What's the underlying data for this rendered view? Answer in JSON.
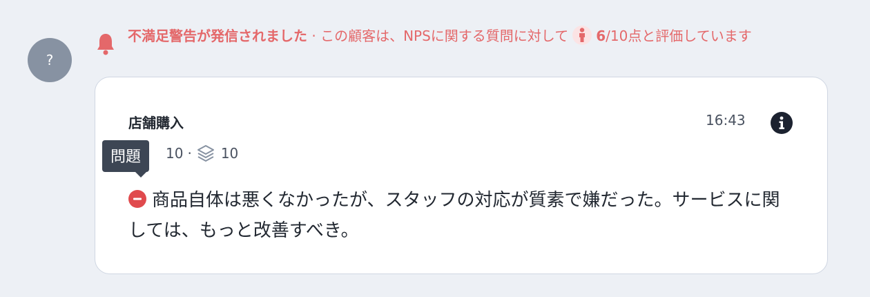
{
  "avatar": {
    "label": "?"
  },
  "alert": {
    "title": "不満足警告が発信されました",
    "separator": "·",
    "text_before": "この顧客は、NPSに関する質問に対して",
    "score": "6",
    "score_suffix": "/10点と評価しています",
    "color": "#e4686a",
    "icon": "bell-icon"
  },
  "card": {
    "title": "店舗購入",
    "time": "16:43",
    "metric_a": "10",
    "metric_separator": "·",
    "metric_b": "10",
    "tooltip": "問題",
    "comment": "商品自体は悪くなかったが、スタッフの対応が質素で嫌だった。サービスに関しては、もっと改善すべき。"
  }
}
